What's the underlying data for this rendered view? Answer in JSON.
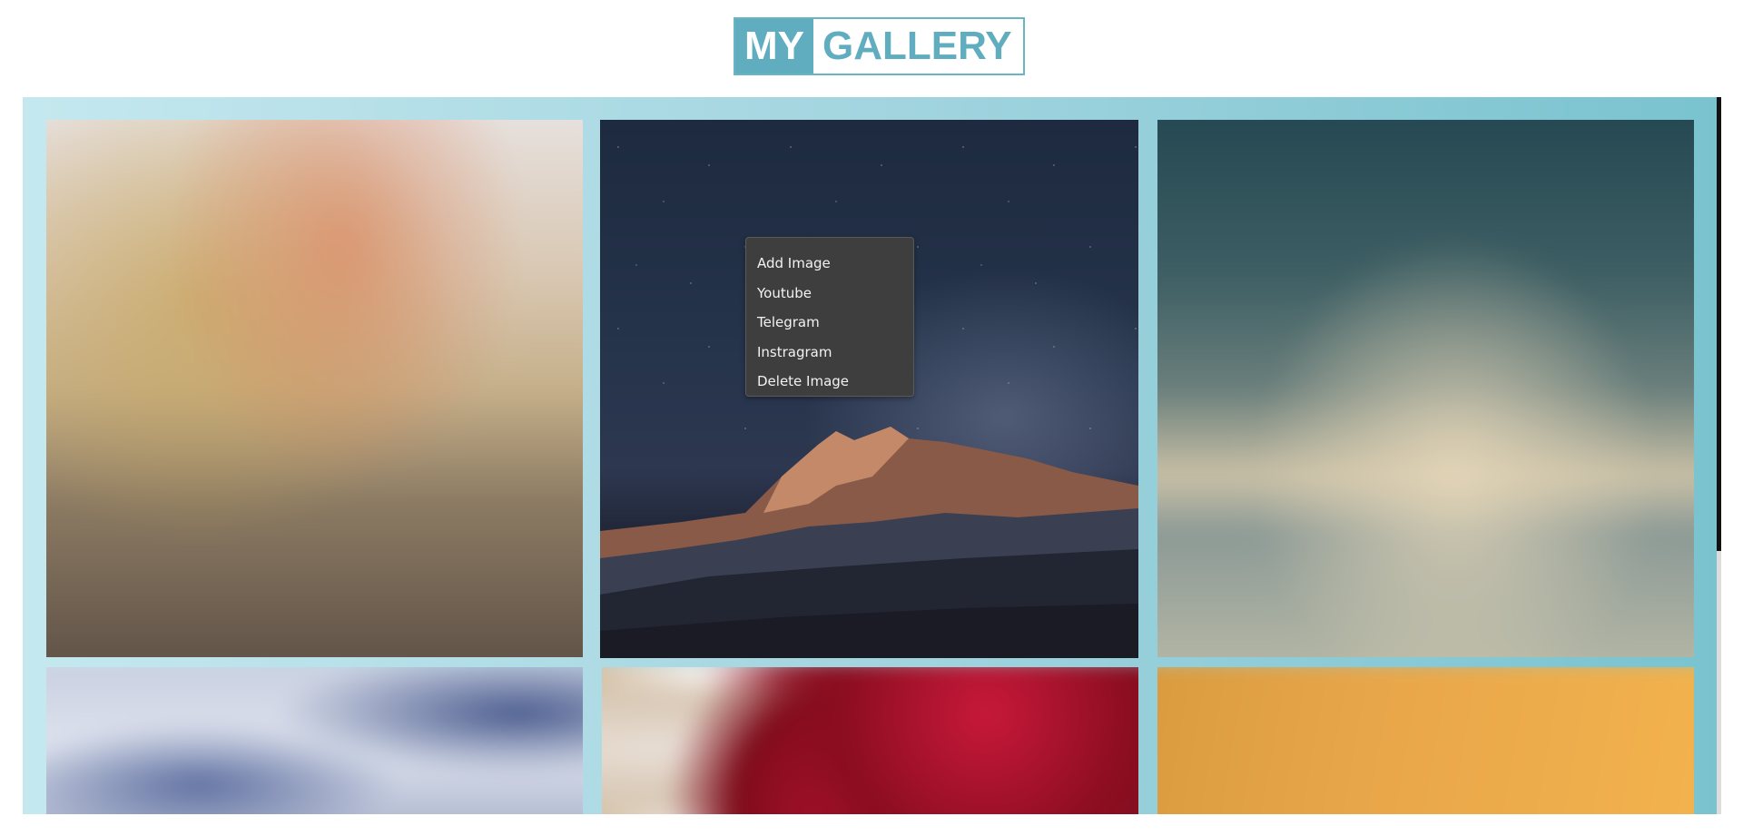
{
  "header": {
    "logo_part1": "MY",
    "logo_part2": "GALLERY",
    "accent_color": "#5fadbf"
  },
  "gallery": {
    "tiles": [
      {
        "name": "wheat-field",
        "state": "blurred"
      },
      {
        "name": "starry-mountain",
        "state": "focused"
      },
      {
        "name": "cloudy-sky",
        "state": "blurred"
      },
      {
        "name": "snowy-water",
        "state": "blurred"
      },
      {
        "name": "raspberries",
        "state": "blurred"
      },
      {
        "name": "orange-texture",
        "state": "blurred"
      }
    ]
  },
  "context_menu": {
    "items": [
      {
        "label": "Add Image"
      },
      {
        "label": "Youtube"
      },
      {
        "label": "Telegram"
      },
      {
        "label": "Instragram"
      },
      {
        "label": "Delete Image"
      }
    ]
  }
}
